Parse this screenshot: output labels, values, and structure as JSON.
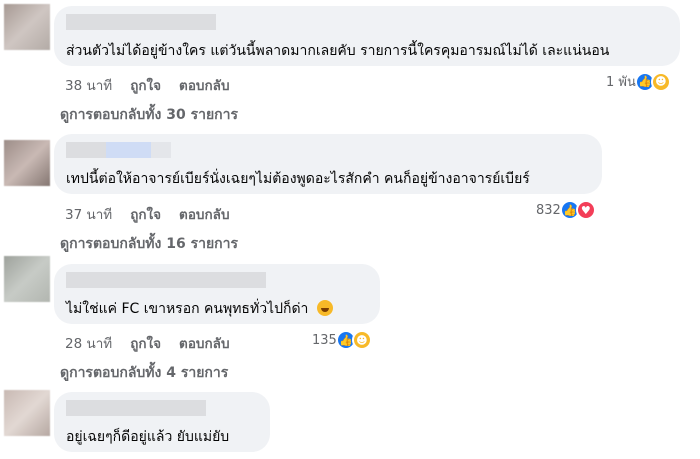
{
  "comments": [
    {
      "text": "ส่วนตัวไม่ได้อยู่ข้างใคร แต่วันนี้พลาดมากเลยคับ รายการนี้ใครคุมอารมณ์ไม่ได้ เละแน่นอน",
      "time": "38 นาที",
      "like_label": "ถูกใจ",
      "reply_label": "ตอบกลับ",
      "reaction_count": "1 พัน",
      "reaction_icons": [
        "like-icon",
        "haha-icon"
      ],
      "view_replies": "ดูการตอบกลับทั้ง 30 รายการ"
    },
    {
      "text": "เทปนี้ต่อให้อาจารย์เบียร์นั่งเฉยๆไม่ต้องพูดอะไรสักคำ คนก็อยู่ข้างอาจารย์เบียร์",
      "time": "37 นาที",
      "like_label": "ถูกใจ",
      "reply_label": "ตอบกลับ",
      "reaction_count": "832",
      "reaction_icons": [
        "like-icon",
        "love-icon"
      ],
      "view_replies": "ดูการตอบกลับทั้ง 16 รายการ"
    },
    {
      "text": "ไม่ใช่แค่ FC เขาหรอก คนพุทธทั่วไปก็ด่า",
      "text_emoji": "rofl-emoji",
      "time": "28 นาที",
      "like_label": "ถูกใจ",
      "reply_label": "ตอบกลับ",
      "reaction_count": "135",
      "reaction_icons": [
        "like-icon",
        "haha-icon"
      ],
      "view_replies": "ดูการตอบกลับทั้ง 4 รายการ"
    },
    {
      "text": "อยู่เฉยๆก็ดีอยู่แล้ว ยับแม่ยับ"
    }
  ],
  "colors": {
    "bubble": "#f0f2f5",
    "meta_text": "#65676b",
    "like": "#1877f2",
    "haha": "#f7b928",
    "love": "#f33e58"
  }
}
